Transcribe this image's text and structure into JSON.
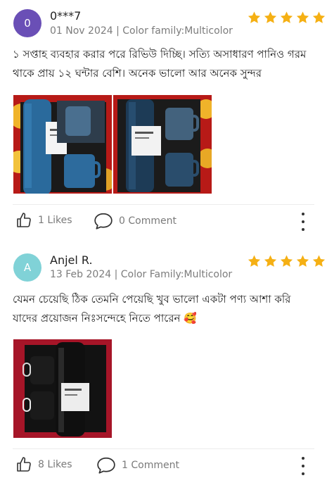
{
  "colors": {
    "star": "#f5b014",
    "avatar_purple": "#6a4fb6",
    "avatar_teal": "#80d2d7"
  },
  "reviews": [
    {
      "avatar_letter": "0",
      "name": "0***7",
      "meta": "01 Nov 2024 | Color family:Multicolor",
      "rating": 5,
      "text": "১ সপ্তাহ ব্যবহার করার পরে রিভিউ দিচ্ছি। সত্যি অসাধারণ পানিও গরম থাকে প্রায় ১২ ঘন্টার বেশি। অনেক ভালো আর অনেক সুন্দর",
      "photos": [
        "thermos-set-photo-1",
        "thermos-set-photo-2"
      ],
      "likes": "1 Likes",
      "comments": "0 Comment"
    },
    {
      "avatar_letter": "A",
      "name": "Anjel R.",
      "meta": "13 Feb 2024 | Color Family:Multicolor",
      "rating": 5,
      "text": "যেমন চেয়েছি ঠিক তেমনি পেয়েছি খুব ভালো একটা পণ্য আশা করি যাদের প্রয়োজন নিঃসন্দেহে নিতে পারেন 🥰",
      "photos": [
        "thermos-set-photo-3"
      ],
      "likes": "8 Likes",
      "comments": "1 Comment"
    }
  ],
  "icons": {
    "like": "thumbs-up-icon",
    "comment": "speech-bubble-icon",
    "more": "more-vertical-icon",
    "star": "star-icon"
  }
}
